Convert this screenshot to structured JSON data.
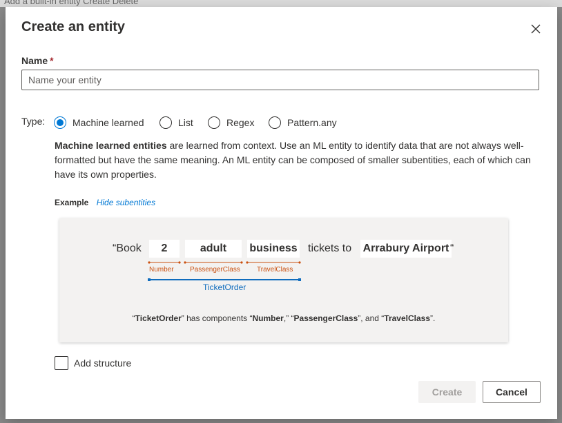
{
  "background": {
    "partial_text": "Add a built-in entity   Create   Delete"
  },
  "dialog": {
    "title": "Create an entity",
    "close_label": "close-icon"
  },
  "name_field": {
    "label": "Name",
    "required_marker": "*",
    "placeholder": "Name your entity",
    "value": ""
  },
  "type": {
    "label": "Type:",
    "options": [
      {
        "label": "Machine learned",
        "checked": true
      },
      {
        "label": "List",
        "checked": false
      },
      {
        "label": "Regex",
        "checked": false
      },
      {
        "label": "Pattern.any",
        "checked": false
      }
    ]
  },
  "description": {
    "bold": "Machine learned entities",
    "rest": " are learned from context. Use an ML entity to identify data that are not always well-formatted but have the same meaning. An ML entity can be composed of smaller subentities, each of which can have its own properties."
  },
  "example": {
    "label": "Example",
    "link": "Hide subentities",
    "sentence": {
      "open": "“Book",
      "tokens": [
        "2",
        "adult",
        "business"
      ],
      "middle": "tickets to",
      "destination": "Arrabury Airport",
      "close": "“"
    },
    "subentities": [
      "Number",
      "PassengerClass",
      "TravelClass"
    ],
    "parent_entity": "TicketOrder",
    "caption": {
      "q1": "“",
      "entity": "TicketOrder",
      "q2": "” has components “",
      "c1": "Number",
      "q3": ",” “",
      "c2": "PassengerClass",
      "q4": "”, and “",
      "c3": "TravelClass",
      "q5": "”."
    }
  },
  "add_structure": {
    "label": "Add structure",
    "checked": false
  },
  "buttons": {
    "create": "Create",
    "cancel": "Cancel"
  },
  "colors": {
    "accent": "#0078d4",
    "subentity": "#ca5010",
    "parent_entity": "#0f6cbd",
    "required": "#a4262c"
  }
}
